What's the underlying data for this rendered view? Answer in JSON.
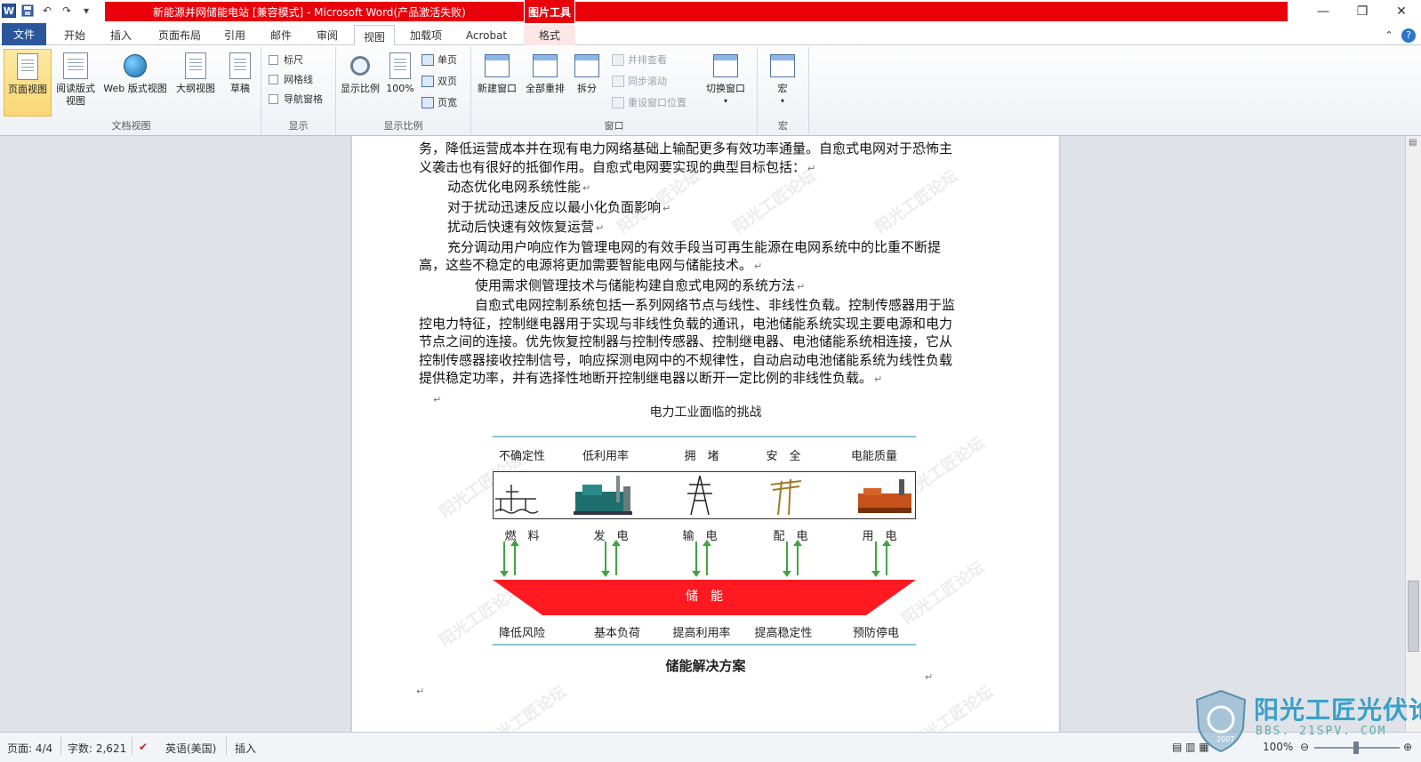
{
  "window": {
    "title": "新能源并网储能电站 [兼容模式] - Microsoft Word(产品激活失败)",
    "context_tab": "图片工具",
    "accent_color": "#e8000b",
    "file_tab_color": "#2b579a"
  },
  "tabs": [
    "文件",
    "开始",
    "插入",
    "页面布局",
    "引用",
    "邮件",
    "审阅",
    "视图",
    "加载项",
    "Acrobat",
    "格式"
  ],
  "active_tab": "视图",
  "ribbon": {
    "doc_views": {
      "label": "文档视图",
      "buttons": [
        "页面视图",
        "阅读版式视图",
        "Web 版式视图",
        "大纲视图",
        "草稿"
      ],
      "reading_line1": "阅读版式",
      "reading_line2": "视图"
    },
    "show": {
      "label": "显示",
      "checkboxes": [
        "标尺",
        "网格线",
        "导航窗格"
      ]
    },
    "zoom": {
      "label": "显示比例",
      "zoom_button": "显示比例",
      "hundred_button": "100%",
      "small": [
        "单页",
        "双页",
        "页宽"
      ]
    },
    "window_group": {
      "label": "窗口",
      "buttons": [
        "新建窗口",
        "全部重排",
        "拆分"
      ],
      "small": [
        "并排查看",
        "同步滚动",
        "重设窗口位置"
      ],
      "switch": "切换窗口"
    },
    "macro": {
      "label": "宏",
      "button": "宏"
    }
  },
  "document": {
    "paragraphs": [
      "务，降低运营成本并在现有电力网络基础上输配更多有效功率通量。自愈式电网对于恐怖主",
      "义袭击也有很好的抵御作用。自愈式电网要实现的典型目标包括：",
      "动态优化电网系统性能",
      "对于扰动迅速反应以最小化负面影响",
      "扰动后快速有效恢复运营",
      "充分调动用户响应作为管理电网的有效手段当可再生能源在电网系统中的比重不断提",
      "高，这些不稳定的电源将更加需要智能电网与储能技术。",
      "使用需求侧管理技术与储能构建自愈式电网的系统方法",
      "自愈式电网控制系统包括一系列网络节点与线性、非线性负载。控制传感器用于监",
      "控电力特征，控制继电器用于实现与非线性负载的通讯，电池储能系统实现主要电源和电力",
      "节点之间的连接。优先恢复控制器与控制传感器、控制继电器、电池储能系统相连接，它从",
      "控制传感器接收控制信号，响应探测电网中的不规律性，自动启动电池储能系统为线性负载",
      "提供稳定功率，并有选择性地断开控制继电器以断开一定比例的非线性负载。"
    ],
    "paragraph_mark": "↵",
    "figure": {
      "title": "电力工业面临的挑战",
      "challenges": [
        "不确定性",
        "低利用率",
        "拥　堵",
        "安　全",
        "电能质量"
      ],
      "chain": [
        "燃　料",
        "发　电",
        "输　电",
        "配　电",
        "用　电"
      ],
      "storage": "储　能",
      "benefits": [
        "降低风险",
        "基本负荷",
        "提高利用率",
        "提高稳定性",
        "预防停电"
      ],
      "caption": "储能解决方案",
      "storage_color": "#ff1a22",
      "arrow_color": "#3fa441"
    },
    "watermark": "阳光工匠论坛"
  },
  "statusbar": {
    "page": "页面: 4/4",
    "words": "字数: 2,621",
    "language": "英语(美国)",
    "mode": "插入",
    "zoom": "100%"
  },
  "forum_logo": {
    "name": "阳光工匠光伏论坛",
    "url": "BBS. 21SPV. COM",
    "year": "2007"
  }
}
